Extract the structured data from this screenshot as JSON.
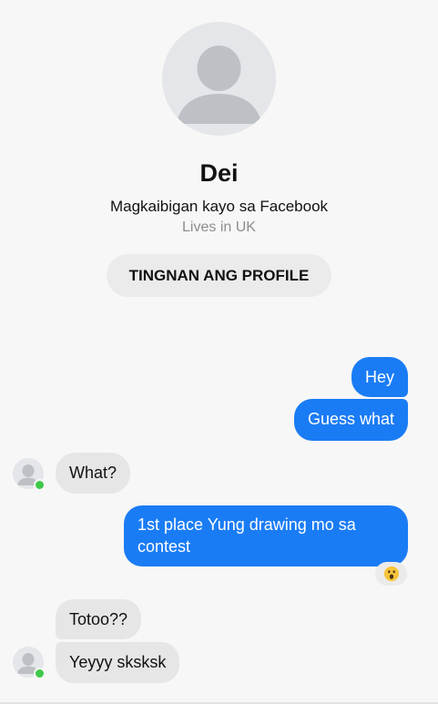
{
  "profile": {
    "name": "Dei",
    "friends_text": "Magkaibigan kayo sa Facebook",
    "location_text": "Lives in UK",
    "view_profile_label": "TINGNAN ANG PROFILE",
    "avatar_icon": "default-person-icon"
  },
  "messages": {
    "hey": "Hey",
    "guess_what": "Guess what",
    "what": "What?",
    "first_place": "1st place Yung drawing mo sa contest",
    "totoo": "Totoo??",
    "yeyyy": "Yeyyy sksksk"
  },
  "reaction": {
    "icon": "wow-emoji-icon"
  },
  "colors": {
    "outgoing_bubble": "#1a7cf5",
    "incoming_bubble": "#e6e6e6",
    "online_dot": "#3fc94a",
    "background": "#f7f7f7"
  }
}
